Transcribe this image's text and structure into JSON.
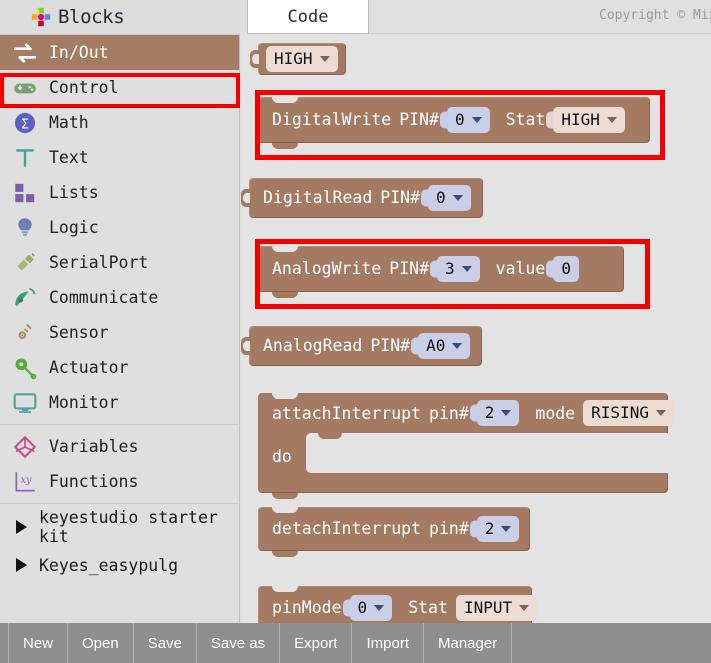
{
  "header": {
    "brand_title": "Blocks",
    "brand_icon": "puzzle-pieces-icon",
    "code_tab_label": "Code",
    "copyright": "Copyright © Mix"
  },
  "sidebar": {
    "categories": [
      {
        "label": "In/Out",
        "icon": "two-arrows-icon",
        "selected": true
      },
      {
        "label": "Control",
        "icon": "gamepad-icon",
        "selected": false
      },
      {
        "label": "Math",
        "icon": "sigma-circle-icon",
        "selected": false
      },
      {
        "label": "Text",
        "icon": "letter-t-icon",
        "selected": false
      },
      {
        "label": "Lists",
        "icon": "squares-grid-icon",
        "selected": false
      },
      {
        "label": "Logic",
        "icon": "lightbulb-icon",
        "selected": false
      },
      {
        "label": "SerialPort",
        "icon": "plug-icon",
        "selected": false
      },
      {
        "label": "Communicate",
        "icon": "satellite-dish-icon",
        "selected": false
      },
      {
        "label": "Sensor",
        "icon": "sensor-waves-icon",
        "selected": false
      },
      {
        "label": "Actuator",
        "icon": "actuator-icon",
        "selected": false
      },
      {
        "label": "Monitor",
        "icon": "display-monitor-icon",
        "selected": false
      }
    ],
    "extras": [
      {
        "label": "Variables",
        "icon": "variables-diamond-icon"
      },
      {
        "label": "Functions",
        "icon": "xy-function-icon"
      }
    ],
    "trees": [
      {
        "label": "keyestudio starter kit",
        "icon": "triangle-right-icon"
      },
      {
        "label": "Keyes_easypulg",
        "icon": "triangle-right-icon"
      }
    ]
  },
  "blocks": {
    "high_value": {
      "label": "HIGH",
      "icon": "chevron-down-icon"
    },
    "digital_write": {
      "name": "DigitalWrite",
      "pin_label": "PIN#",
      "pin_value": "0",
      "state_label": "Stat",
      "state_value": "HIGH",
      "highlighted": true
    },
    "digital_read": {
      "name": "DigitalRead",
      "pin_label": "PIN#",
      "pin_value": "0"
    },
    "analog_write": {
      "name": "AnalogWrite",
      "pin_label": "PIN#",
      "pin_value": "3",
      "value_label": "value",
      "value_value": "0",
      "highlighted": true
    },
    "analog_read": {
      "name": "AnalogRead",
      "pin_label": "PIN#",
      "pin_value": "A0"
    },
    "attach_interrupt": {
      "name": "attachInterrupt",
      "pin_label": "pin#",
      "pin_value": "2",
      "mode_label": "mode",
      "mode_value": "RISING",
      "do_label": "do"
    },
    "detach_interrupt": {
      "name": "detachInterrupt",
      "pin_label": "pin#",
      "pin_value": "2"
    },
    "pin_mode": {
      "name": "pinMode",
      "pin_value": "0",
      "state_label": "Stat",
      "state_value": "INPUT"
    }
  },
  "toolbar": {
    "buttons": [
      "New",
      "Open",
      "Save",
      "Save as",
      "Export",
      "Import",
      "Manager"
    ]
  },
  "colors": {
    "block_brown": "#a57a62",
    "highlight_red": "#f50000",
    "number_field": "#c8cfe6",
    "dropdown_field": "#ecdcd4",
    "selected_category": "#a47c63",
    "toolbar_gray": "#8f8f8f"
  }
}
